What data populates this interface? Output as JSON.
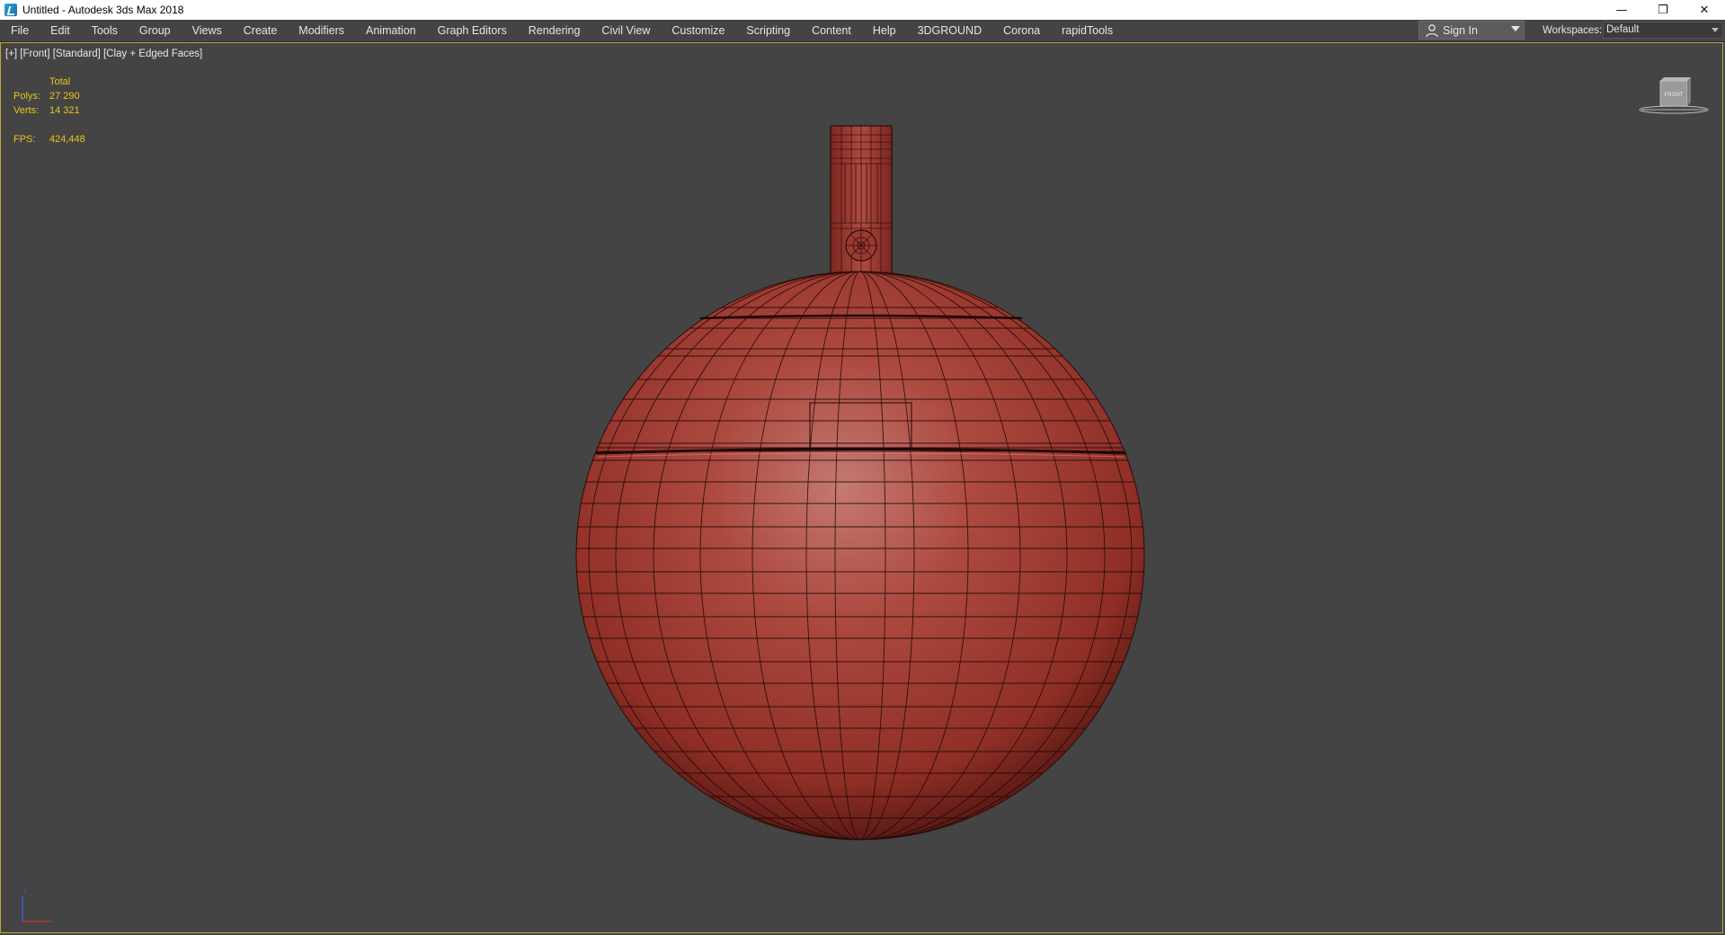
{
  "window": {
    "title": "Untitled - Autodesk 3ds Max 2018",
    "controls": {
      "minimize": "—",
      "restore": "❐",
      "close": "✕"
    }
  },
  "menu": {
    "items": [
      "File",
      "Edit",
      "Tools",
      "Group",
      "Views",
      "Create",
      "Modifiers",
      "Animation",
      "Graph Editors",
      "Rendering",
      "Civil View",
      "Customize",
      "Scripting",
      "Content",
      "Help",
      "3DGROUND",
      "Corona",
      "rapidTools"
    ]
  },
  "account": {
    "sign_in_label": "Sign In"
  },
  "workspace": {
    "label": "Workspaces:",
    "value": "Default"
  },
  "viewport": {
    "label": "[+] [Front] [Standard] [Clay + Edged Faces]",
    "stats": {
      "header": "Total",
      "polys_label": "Polys:",
      "polys_value": "27 290",
      "verts_label": "Verts:",
      "verts_value": "14 321",
      "fps_label": "FPS:",
      "fps_value": "424,448"
    },
    "viewcube_label": "FRONT",
    "colors": {
      "background": "#444444",
      "model": "#9e3a30",
      "stats_text": "#e8c51c",
      "active_border": "#c3a437"
    }
  }
}
